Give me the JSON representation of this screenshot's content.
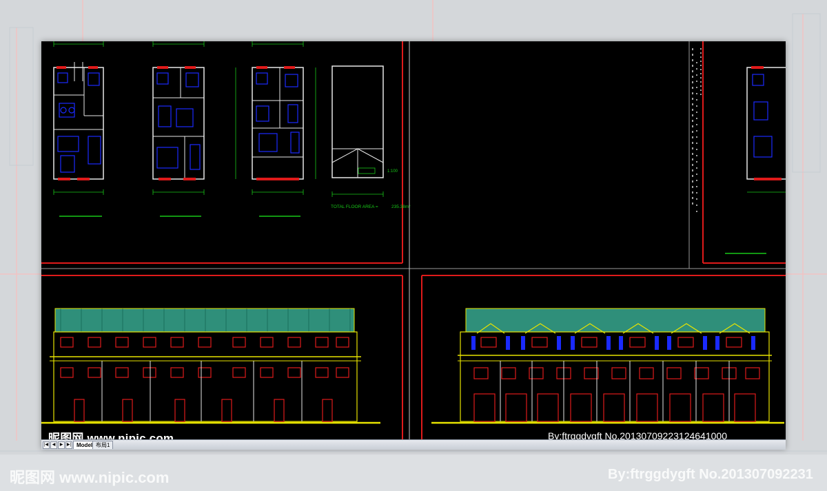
{
  "drawing": {
    "total_area_label": "TOTAL FLOOR AREA =",
    "total_area_value": "235.38m²",
    "scale_label": "1:100"
  },
  "tabs": {
    "model": "Model",
    "layout": "布局1"
  },
  "watermark": {
    "left": "昵图网 www.nipic.com",
    "right": "By:ftrggdygft  No.20130709223124641000",
    "bg_left": "昵图网 www.nipic.com",
    "bg_right": "By:ftrggdygft  No.201307092231"
  },
  "colors": {
    "background": "#000000",
    "frame_red": "#e01a1a",
    "dimension_green": "#18c918",
    "furniture_blue": "#1a2aff",
    "elevation_yellow": "#e8e400",
    "roof_teal": "#2f8f7a"
  }
}
